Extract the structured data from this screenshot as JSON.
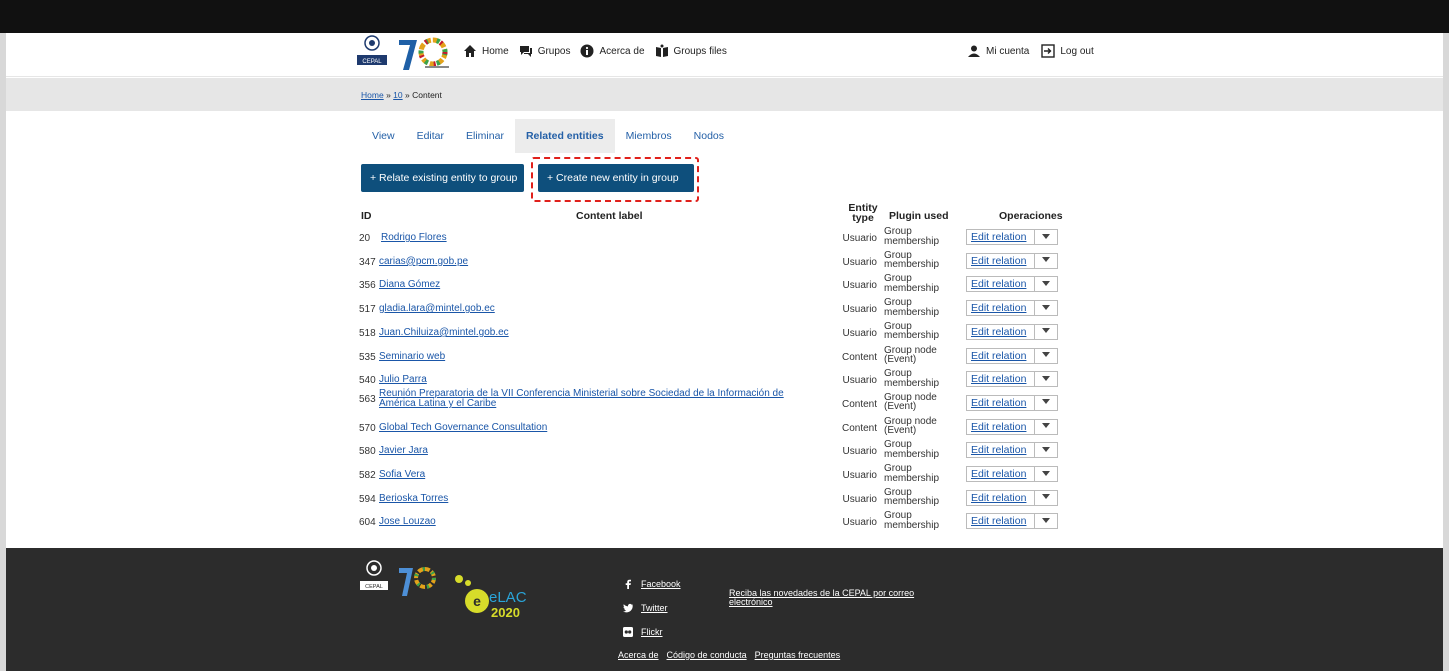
{
  "header": {
    "logo_un_text": "CEPAL",
    "nav": [
      {
        "label": "Home",
        "icon": "home-icon"
      },
      {
        "label": "Grupos",
        "icon": "chat-icon"
      },
      {
        "label": "Acerca de",
        "icon": "info-icon"
      },
      {
        "label": "Groups files",
        "icon": "files-icon"
      }
    ],
    "user_nav": [
      {
        "label": "Mi cuenta",
        "icon": "user-icon"
      },
      {
        "label": "Log out",
        "icon": "logout-icon"
      }
    ]
  },
  "breadcrumb": {
    "items": [
      "Home",
      "10"
    ],
    "current": "Content",
    "separator": "»"
  },
  "tabs": [
    {
      "label": "View"
    },
    {
      "label": "Editar"
    },
    {
      "label": "Eliminar"
    },
    {
      "label": "Related entities",
      "active": true
    },
    {
      "label": "Miembros"
    },
    {
      "label": "Nodos"
    }
  ],
  "actions": {
    "relate_label": "+ Relate existing entity to group",
    "create_label": "+ Create new entity in group"
  },
  "table": {
    "headers": {
      "id": "ID",
      "label": "Content label",
      "type_line1": "Entity",
      "type_line2": "type",
      "plugin": "Plugin used",
      "ops": "Operaciones"
    },
    "edit_label": "Edit relation",
    "rows": [
      {
        "id": "20",
        "label": "Rodrigo Flores",
        "type": "Usuario",
        "plugin1": "Group",
        "plugin2": "membership"
      },
      {
        "id": "347",
        "label": "carias@pcm.gob.pe",
        "type": "Usuario",
        "plugin1": "Group",
        "plugin2": "membership"
      },
      {
        "id": "356",
        "label": "Diana Gómez",
        "type": "Usuario",
        "plugin1": "Group",
        "plugin2": "membership"
      },
      {
        "id": "517",
        "label": "gladia.lara@mintel.gob.ec",
        "type": "Usuario",
        "plugin1": "Group",
        "plugin2": "membership"
      },
      {
        "id": "518",
        "label": "Juan.Chiluiza@mintel.gob.ec",
        "type": "Usuario",
        "plugin1": "Group",
        "plugin2": "membership"
      },
      {
        "id": "535",
        "label": "Seminario web",
        "type": "Content",
        "plugin1": "Group node",
        "plugin2": "(Event)"
      },
      {
        "id": "540",
        "label": "Julio Parra",
        "type": "Usuario",
        "plugin1": "Group",
        "plugin2": "membership"
      },
      {
        "id": "563",
        "label": "Reunión Preparatoria de la VII Conferencia Ministerial sobre Sociedad de la Información de",
        "label2": "América Latina y el Caribe",
        "type": "Content",
        "plugin1": "Group node",
        "plugin2": "(Event)"
      },
      {
        "id": "570",
        "label": "Global Tech Governance Consultation",
        "type": "Content",
        "plugin1": "Group node",
        "plugin2": "(Event)"
      },
      {
        "id": "580",
        "label": "Javier Jara",
        "type": "Usuario",
        "plugin1": "Group",
        "plugin2": "membership"
      },
      {
        "id": "582",
        "label": "Sofia Vera",
        "type": "Usuario",
        "plugin1": "Group",
        "plugin2": "membership"
      },
      {
        "id": "594",
        "label": "Berioska Torres",
        "type": "Usuario",
        "plugin1": "Group",
        "plugin2": "membership"
      },
      {
        "id": "604",
        "label": "Jose Louzao",
        "type": "Usuario",
        "plugin1": "Group",
        "plugin2": "membership"
      }
    ]
  },
  "footer": {
    "elac_text1": "eLAC",
    "elac_text2": "2020",
    "social": [
      {
        "label": "Facebook",
        "icon": "facebook-icon"
      },
      {
        "label": "Twitter",
        "icon": "twitter-icon"
      },
      {
        "label": "Flickr",
        "icon": "flickr-icon"
      }
    ],
    "newsletter": "Reciba las novedades de la CEPAL por correo electrónico",
    "links": [
      "Acerca de",
      "Código de conducta",
      "Preguntas frecuentes"
    ]
  },
  "colors": {
    "accent": "#0e4f7c",
    "link": "#1a56a8",
    "highlight": "#e0201b",
    "footer_bg": "#2c2c2c"
  }
}
